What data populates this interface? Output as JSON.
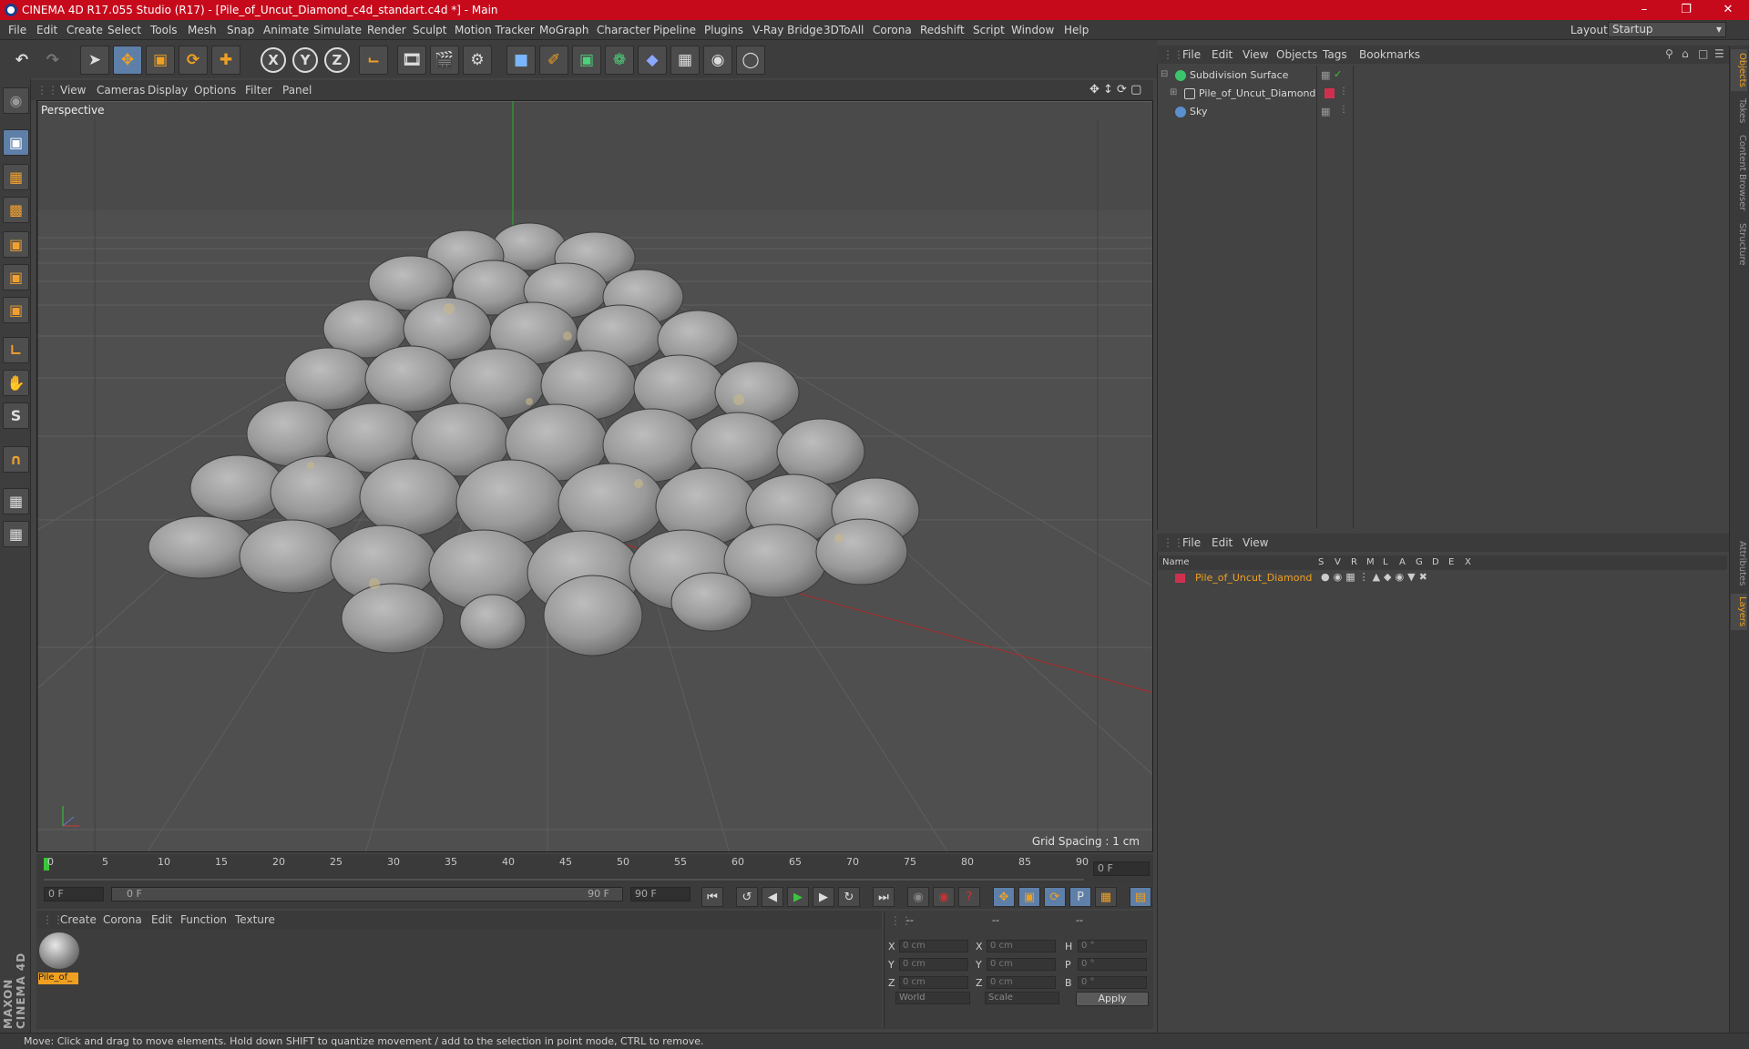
{
  "window": {
    "title": "CINEMA 4D R17.055 Studio (R17) - [Pile_of_Uncut_Diamond_c4d_standart.c4d *] - Main"
  },
  "menubar": {
    "items": [
      "File",
      "Edit",
      "Create",
      "Select",
      "Tools",
      "Mesh",
      "Snap",
      "Animate",
      "Simulate",
      "Render",
      "Sculpt",
      "Motion Tracker",
      "MoGraph",
      "Character",
      "Pipeline",
      "Plugins",
      "V-Ray Bridge",
      "3DToAll",
      "Corona",
      "Redshift",
      "Script",
      "Window",
      "Help"
    ],
    "layout_label": "Layout:",
    "layout_value": "Startup"
  },
  "toolbar": {
    "axis_x": "X",
    "axis_y": "Y",
    "axis_z": "Z"
  },
  "viewport": {
    "menu": [
      "View",
      "Cameras",
      "Display",
      "Options",
      "Filter",
      "Panel"
    ],
    "label": "Perspective",
    "grid_spacing": "Grid Spacing : 1 cm"
  },
  "timeline": {
    "ticks": [
      "0",
      "5",
      "10",
      "15",
      "20",
      "25",
      "30",
      "35",
      "40",
      "45",
      "50",
      "55",
      "60",
      "65",
      "70",
      "75",
      "80",
      "85",
      "90"
    ],
    "current_frame": "0 F",
    "start_field": "0 F",
    "range_start": "0 F",
    "range_end": "90 F",
    "end_field": "90 F"
  },
  "material_manager": {
    "menu": [
      "Create",
      "Corona",
      "Edit",
      "Function",
      "Texture"
    ],
    "material_name": "Pile_of_"
  },
  "coordinates": {
    "header": [
      "--",
      "--",
      "--"
    ],
    "rows": [
      {
        "a": "X",
        "av": "0 cm",
        "b": "X",
        "bv": "0 cm",
        "c": "H",
        "cv": "0 °"
      },
      {
        "a": "Y",
        "av": "0 cm",
        "b": "Y",
        "bv": "0 cm",
        "c": "P",
        "cv": "0 °"
      },
      {
        "a": "Z",
        "av": "0 cm",
        "b": "Z",
        "bv": "0 cm",
        "c": "B",
        "cv": "0 °"
      }
    ],
    "mode1": "World",
    "mode2": "Scale",
    "apply": "Apply"
  },
  "object_manager": {
    "menu": [
      "File",
      "Edit",
      "View",
      "Objects",
      "Tags",
      "Bookmarks"
    ],
    "objects": [
      {
        "name": "Subdivision Surface",
        "color": "#3cc46c"
      },
      {
        "name": "Pile_of_Uncut_Diamond",
        "color": "#e04060"
      },
      {
        "name": "Sky",
        "color": "#5a8fd0"
      }
    ]
  },
  "layer_manager": {
    "menu": [
      "File",
      "Edit",
      "View"
    ],
    "columns": [
      "Name",
      "S",
      "V",
      "R",
      "M",
      "L",
      "A",
      "G",
      "D",
      "E",
      "X"
    ],
    "layer_name": "Pile_of_Uncut_Diamond"
  },
  "right_tabs": [
    "Objects",
    "Takes",
    "Content Browser",
    "Structure",
    "Attributes",
    "Layers"
  ],
  "brand": "MAXON CINEMA 4D",
  "status": {
    "text": "Move: Click and drag to move elements. Hold down SHIFT to quantize movement / add to the selection in point mode, CTRL to remove."
  }
}
